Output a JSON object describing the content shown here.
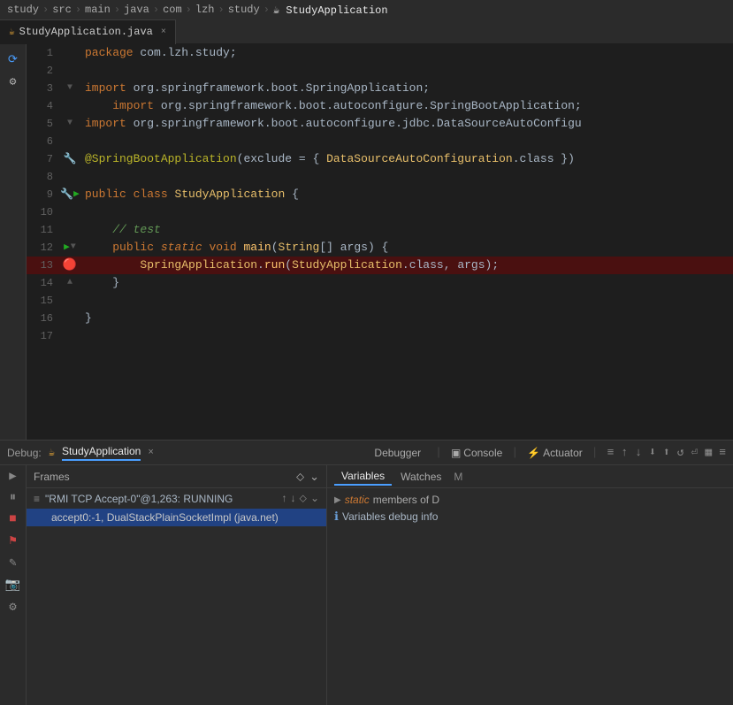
{
  "breadcrumb": {
    "items": [
      "study",
      "src",
      "main",
      "java",
      "com",
      "lzh",
      "study"
    ],
    "active": "StudyApplication"
  },
  "tab": {
    "label": "StudyApplication.java",
    "icon": "☕",
    "close": "×"
  },
  "code": {
    "lines": [
      {
        "num": 1,
        "content": "package com.lzh.study;",
        "gutter": ""
      },
      {
        "num": 2,
        "content": "",
        "gutter": ""
      },
      {
        "num": 3,
        "content": "import org.springframework.boot.SpringApplication;",
        "gutter": "fold"
      },
      {
        "num": 4,
        "content": "    import org.springframework.boot.autoconfigure.SpringBootApplication;",
        "gutter": ""
      },
      {
        "num": 5,
        "content": "import org.springframework.boot.autoconfigure.jdbc.DataSourceAutoConfigu",
        "gutter": "fold"
      },
      {
        "num": 6,
        "content": "",
        "gutter": ""
      },
      {
        "num": 7,
        "content": "@SpringBootApplication(exclude = { DataSourceAutoConfiguration.class })",
        "gutter": "ann",
        "annIcon": "🔧"
      },
      {
        "num": 8,
        "content": "",
        "gutter": ""
      },
      {
        "num": 9,
        "content": "public class StudyApplication {",
        "gutter": "run"
      },
      {
        "num": 10,
        "content": "",
        "gutter": ""
      },
      {
        "num": 11,
        "content": "    // test",
        "gutter": ""
      },
      {
        "num": 12,
        "content": "    public static void main(String[] args) {",
        "gutter": "run"
      },
      {
        "num": 13,
        "content": "        SpringApplication.run(StudyApplication.class, args);",
        "gutter": "bp",
        "highlight": true
      },
      {
        "num": 14,
        "content": "    }",
        "gutter": "fold"
      },
      {
        "num": 15,
        "content": "",
        "gutter": ""
      },
      {
        "num": 16,
        "content": "}",
        "gutter": ""
      },
      {
        "num": 17,
        "content": "",
        "gutter": ""
      }
    ]
  },
  "debug": {
    "label": "Debug:",
    "session_icon": "☕",
    "session_name": "StudyApplication",
    "close": "×",
    "tabs": [
      "Debugger",
      "Console",
      "Actuator"
    ],
    "toolbar_icons": [
      "≡",
      "↑",
      "↓",
      "↓↑",
      "↑↓",
      "↺",
      "⏎",
      "▣",
      "≡≡"
    ],
    "frames_label": "Frames",
    "thread_text": "\"RMI TCP Accept-0\"@1,263: RUNNING",
    "frame_text": "accept0:-1, DualStackPlainSocketImpl (java.net)",
    "variables_tabs": [
      "Variables",
      "Watches",
      "M"
    ],
    "static_members": "static members of D",
    "variables_debug_info": "Variables debug info",
    "filter_icon": "⬦",
    "down_icon": "⌄"
  }
}
